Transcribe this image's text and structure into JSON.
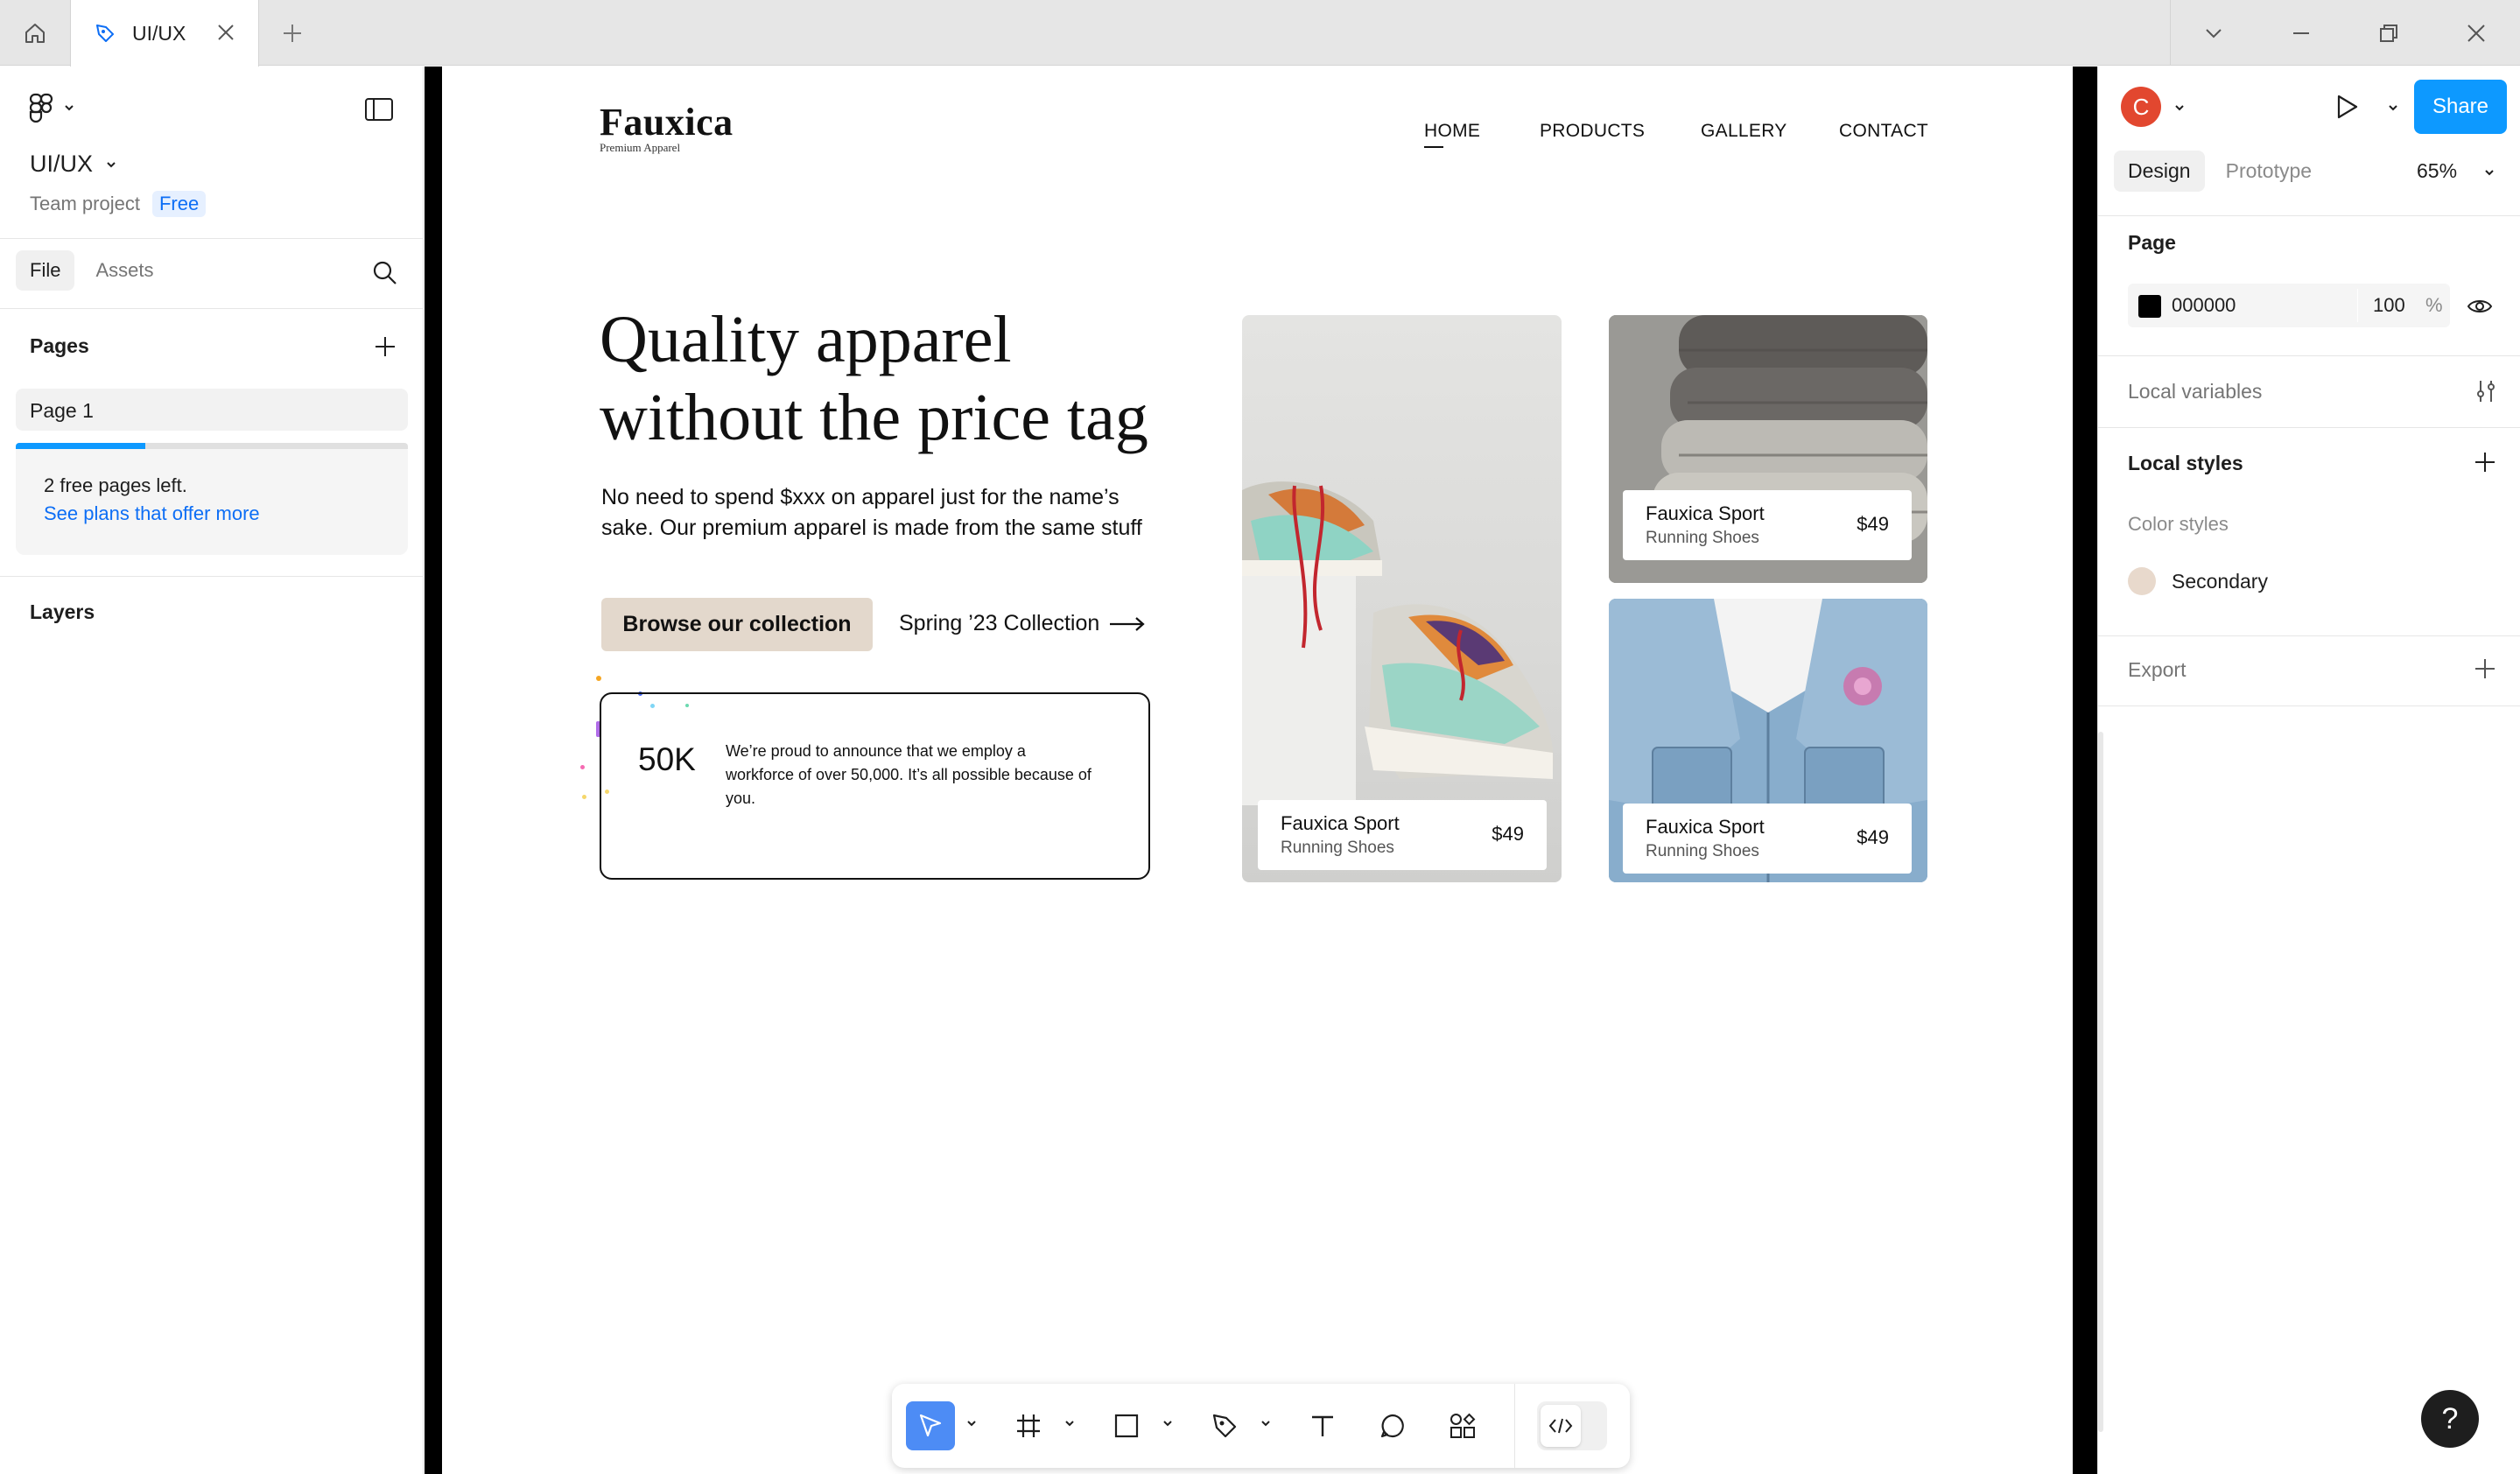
{
  "titlebar": {
    "tab_label": "UI/UX",
    "icons": [
      "home-icon",
      "figma-file-icon",
      "close-icon",
      "plus-icon",
      "chevron-down-icon",
      "minimize-icon",
      "restore-icon",
      "close-window-icon"
    ]
  },
  "left_panel": {
    "project_name": "UI/UX",
    "team_label": "Team project",
    "plan_badge": "Free",
    "tabs": [
      "File",
      "Assets"
    ],
    "pages_title": "Pages",
    "page_items": [
      "Page 1"
    ],
    "quota_text": "2 free pages left.",
    "quota_link": "See plans that offer more",
    "quota_progress": 0.33,
    "layers_title": "Layers"
  },
  "canvas": {
    "logo": "Fauxica",
    "logo_sub": "Premium Apparel",
    "nav": [
      "HOME",
      "PRODUCTS",
      "GALLERY",
      "CONTACT"
    ],
    "hero_title_line1": "Quality apparel",
    "hero_title_line2": "without the price tag",
    "hero_text": "No need to spend $xxx on apparel just for the name’s sake. Our premium apparel is made from the same stuff",
    "cta_button": "Browse our collection",
    "secondary_link": "Spring ’23 Collection",
    "stat_value": "50K",
    "stat_text": "We’re proud to announce that we employ a workforce of over 50,000. It’s all possible because of you.",
    "products": [
      {
        "name": "Fauxica Sport",
        "subtitle": "Running Shoes",
        "price": "$49"
      },
      {
        "name": "Fauxica Sport",
        "subtitle": "Running Shoes",
        "price": "$49"
      },
      {
        "name": "Fauxica Sport",
        "subtitle": "Running Shoes",
        "price": "$49"
      }
    ],
    "colors": {
      "accent_button": "#e3d8cc",
      "frame_bg": "#ffffff",
      "canvas_bg": "#000000"
    }
  },
  "toolbar": {
    "tools": [
      "move-tool-icon",
      "frame-tool-icon",
      "rectangle-tool-icon",
      "pen-tool-icon",
      "text-tool-icon",
      "comment-tool-icon",
      "actions-icon",
      "dev-mode-icon"
    ]
  },
  "right_panel": {
    "avatar_initial": "C",
    "share_label": "Share",
    "tabs": [
      "Design",
      "Prototype"
    ],
    "zoom": "65%",
    "page_section": "Page",
    "page_fill_hex": "000000",
    "page_fill_opacity": "100",
    "page_fill_unit": "%",
    "local_variables": "Local variables",
    "local_styles": "Local styles",
    "color_styles": "Color styles",
    "style_name": "Secondary",
    "export": "Export",
    "help": "?",
    "colors": {
      "share_button": "#0d99ff",
      "avatar": "#e2472f",
      "secondary_style": "#e8d9cc"
    }
  }
}
